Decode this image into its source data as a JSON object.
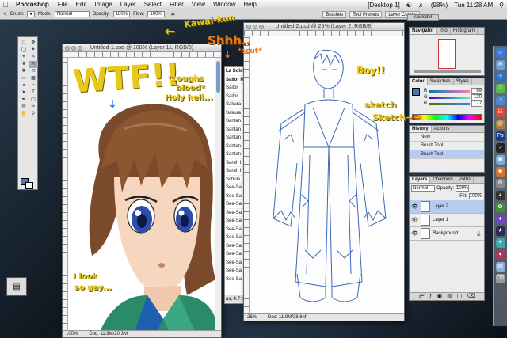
{
  "menubar": {
    "app": "Photoshop",
    "items": [
      "File",
      "Edit",
      "Image",
      "Layer",
      "Select",
      "Filter",
      "View",
      "Window",
      "Help"
    ],
    "desktop": "[Desktop 1]",
    "battery": "(98%)",
    "clock": "Tue 11:28 AM"
  },
  "options": {
    "tool": "Brush:",
    "mode_label": "Mode:",
    "mode_value": "Normal",
    "opacity_label": "Opacity:",
    "opacity_value": "100%",
    "flow_label": "Flow:",
    "flow_value": "100%",
    "tabs": [
      "Brushes",
      "Tool Presets",
      "Layer Comps"
    ]
  },
  "doc1": {
    "title": "Untitled-1.psd @ 100% (Layer 11, RGB/8)",
    "zoom": "100%",
    "info": "Doc: 11.9M/20.3M"
  },
  "doc2": {
    "title": "Untitled-2.psd @ 25% (Layer 2, RGB/8)",
    "zoom": "25%",
    "info": "Doc: 11.9M/28.8M"
  },
  "list": {
    "header": [
      "La Soldie",
      "Sailor Mo"
    ],
    "rows": [
      "Sailor",
      "Sailor",
      "Sakura",
      "Sakura",
      "Santan",
      "Santan",
      "Santan",
      "Santan",
      "Santan",
      "Sarah I",
      "Sarah I",
      "Schule",
      "See-Sa",
      "See-Sa",
      "See-Sa",
      "See-Sa",
      "See-Sa",
      "See-Sa",
      "See-Sa",
      "See-Sa",
      "See-Sa",
      "See-Sa",
      "See-Sa",
      "See-Sa"
    ],
    "footer": "as, 4.7 da"
  },
  "navigator": {
    "tabs": [
      "Navigator",
      "Info",
      "Histogram"
    ]
  },
  "color": {
    "tabs": [
      "Color",
      "Swatches",
      "Styles"
    ],
    "r_value": "69",
    "g_value": "120",
    "b_value": "177",
    "fg_color": "#4578b1"
  },
  "history": {
    "tabs": [
      "History",
      "Actions"
    ],
    "items": [
      "New",
      "Brush Tool",
      "Brush Tool"
    ]
  },
  "layers": {
    "tabs": [
      "Layers",
      "Channels",
      "Paths"
    ],
    "mode": "Normal",
    "opacity_label": "Opacity:",
    "opacity_value": "100%",
    "fill_label": "Fill:",
    "fill_value": "100%",
    "rows": [
      {
        "name": "Layer 2",
        "selected": true
      },
      {
        "name": "Layer 1",
        "selected": false
      },
      {
        "name": "Background",
        "selected": false
      }
    ]
  },
  "finder_tab": "souledel",
  "annotations": {
    "wtf": "WTF!!",
    "coughs": "*coughs",
    "blood": "blood*",
    "holy": "Holy hell...",
    "kawai": "Kawai-kun",
    "shhh": "Shhh..",
    "scut": "*scut*",
    "boy": "Boy!!",
    "sketch": "sketch",
    "sketch2": "Sketch~~",
    "look1": "I look",
    "look2": "so gay..."
  },
  "colors": {
    "annotation_yellow": "#e8c81a",
    "annotation_blue": "#2d78d6",
    "selection_blue": "#b6cdf0"
  }
}
